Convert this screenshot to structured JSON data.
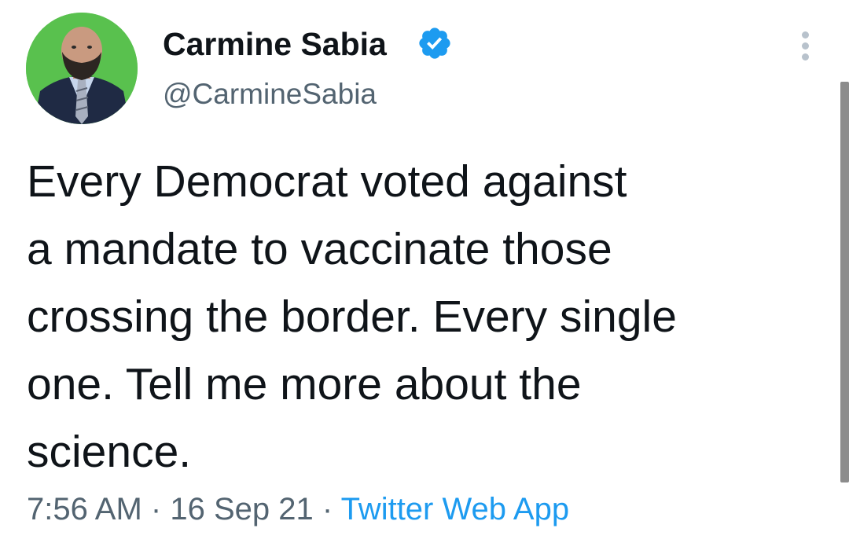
{
  "tweet": {
    "author": {
      "display_name": "Carmine Sabia",
      "handle": "@CarmineSabia",
      "verified": true
    },
    "text_lines": [
      "Every Democrat voted against",
      "a mandate to vaccinate those",
      "crossing the border. Every single",
      "one. Tell me more about the",
      "science."
    ],
    "meta": {
      "time": "7:56 AM",
      "separator": "·",
      "date": "16 Sep 21",
      "source": "Twitter Web App"
    }
  },
  "icons": {
    "verified": "verified-badge-icon",
    "more": "more-vertical-icon"
  },
  "colors": {
    "text": "#0f1419",
    "secondary": "#536471",
    "accent": "#1d9bf0",
    "avatar_background": "#59c14e"
  }
}
